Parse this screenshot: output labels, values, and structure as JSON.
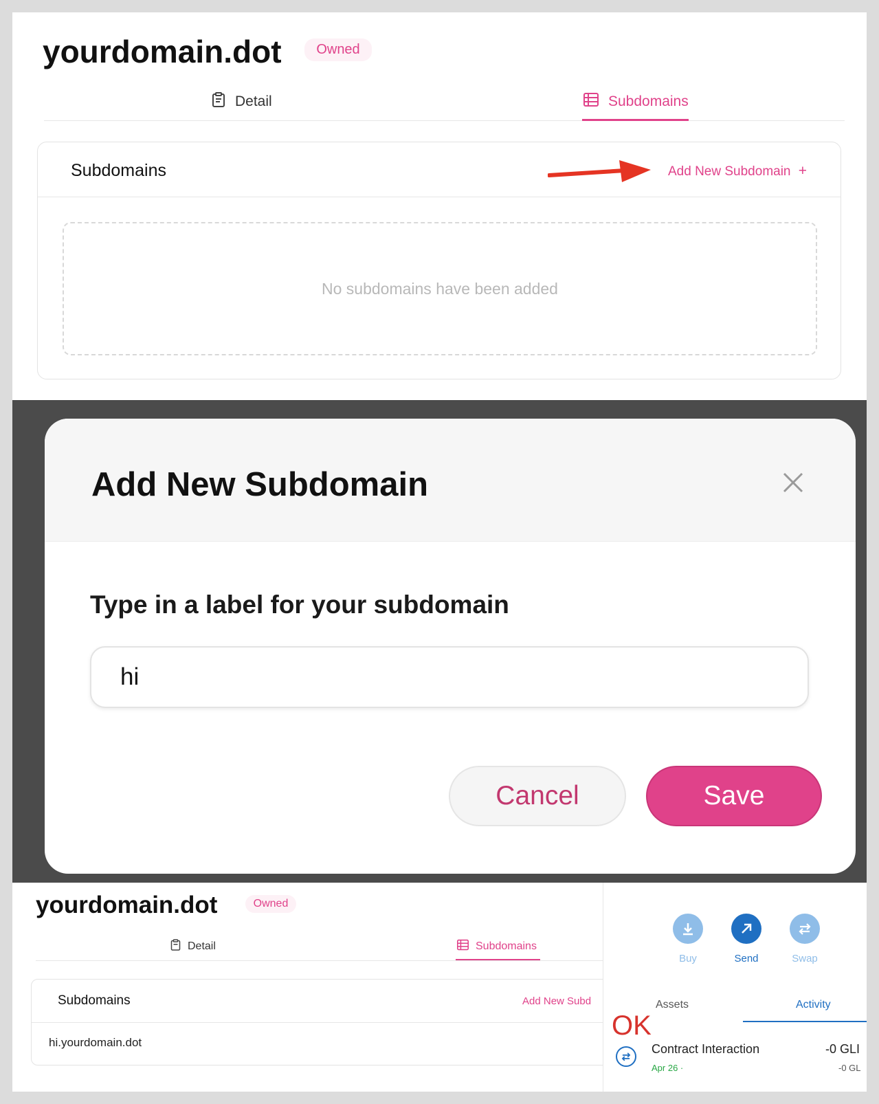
{
  "top_panel": {
    "domain": "yourdomain.dot",
    "badge": "Owned",
    "tabs": [
      {
        "label": "Detail",
        "icon": "clipboard-icon",
        "active": false
      },
      {
        "label": "Subdomains",
        "icon": "list-icon",
        "active": true
      }
    ],
    "card": {
      "title": "Subdomains",
      "add_link": "Add New Subdomain",
      "add_glyph": "+",
      "empty_text": "No subdomains have been added"
    },
    "annotation": "red-arrow-icon"
  },
  "modal": {
    "title": "Add New Subdomain",
    "label": "Type in a label for your subdomain",
    "input_value": "hi",
    "cancel_label": "Cancel",
    "save_label": "Save"
  },
  "bottom_panel": {
    "domain": "yourdomain.dot",
    "badge": "Owned",
    "tabs": [
      {
        "label": "Detail",
        "active": false
      },
      {
        "label": "Subdomains",
        "active": true
      }
    ],
    "card": {
      "title": "Subdomains",
      "add_link": "Add New Subd",
      "row": "hi.yourdomain.dot"
    },
    "wallet": {
      "actions": [
        {
          "label": "Buy",
          "icon": "download-icon",
          "color": "#8fbde8"
        },
        {
          "label": "Send",
          "icon": "arrow-up-right-icon",
          "color": "#1f6fc2"
        },
        {
          "label": "Swap",
          "icon": "swap-icon",
          "color": "#8fbde8"
        }
      ],
      "tabs": [
        "Assets",
        "Activity"
      ],
      "active_tab": "Activity",
      "ok_text": "OK",
      "activity": {
        "title": "Contract Interaction",
        "date": "Apr 26 · ",
        "amount": "-0 GLI",
        "sub_amount": "-0 GL"
      }
    }
  },
  "colors": {
    "accent": "#e0428a",
    "wallet_blue": "#1f6fc2",
    "ok_red": "#d7332d"
  }
}
